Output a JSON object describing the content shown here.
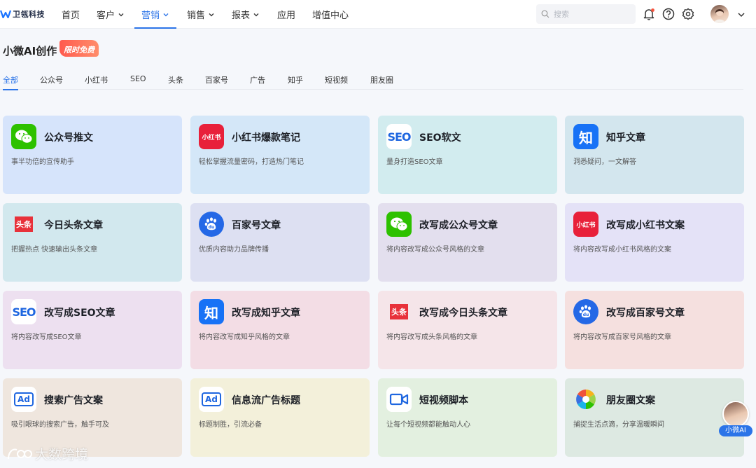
{
  "brand": {
    "name": "卫瓴科技"
  },
  "nav": {
    "items": [
      {
        "label": "首页"
      },
      {
        "label": "客户"
      },
      {
        "label": "营销"
      },
      {
        "label": "销售"
      },
      {
        "label": "报表"
      },
      {
        "label": "应用"
      },
      {
        "label": "增值中心"
      }
    ],
    "active": "营销"
  },
  "search": {
    "placeholder": "搜索"
  },
  "page": {
    "title": "小微AI创作",
    "badge": "限时免费"
  },
  "tabs": [
    {
      "label": "全部"
    },
    {
      "label": "公众号"
    },
    {
      "label": "小红书"
    },
    {
      "label": "SEO"
    },
    {
      "label": "头条"
    },
    {
      "label": "百家号"
    },
    {
      "label": "广告"
    },
    {
      "label": "知乎"
    },
    {
      "label": "短视频"
    },
    {
      "label": "朋友圈"
    }
  ],
  "active_tab": "全部",
  "cards": [
    {
      "title": "公众号推文",
      "desc": "事半功倍的宣传助手",
      "icon": "wechat-icon"
    },
    {
      "title": "小红书爆款笔记",
      "desc": "轻松掌握流量密码，打造热门笔记",
      "icon": "xiaohongshu-icon"
    },
    {
      "title": "SEO软文",
      "desc": "量身打造SEO文章",
      "icon": "seo-icon"
    },
    {
      "title": "知乎文章",
      "desc": "洞悉疑问，一文解答",
      "icon": "zhihu-icon"
    },
    {
      "title": "今日头条文章",
      "desc": "把握热点 快速输出头条文章",
      "icon": "toutiao-icon"
    },
    {
      "title": "百家号文章",
      "desc": "优质内容助力品牌传播",
      "icon": "baijiahao-icon"
    },
    {
      "title": "改写成公众号文章",
      "desc": "将内容改写成公众号风格的文章",
      "icon": "wechat-icon"
    },
    {
      "title": "改写成小红书文案",
      "desc": "将内容改写成小红书风格的文案",
      "icon": "xiaohongshu-icon"
    },
    {
      "title": "改写成SEO文章",
      "desc": "将内容改写成SEO文章",
      "icon": "seo-icon"
    },
    {
      "title": "改写成知乎文章",
      "desc": "将内容改写成知乎风格的文章",
      "icon": "zhihu-icon"
    },
    {
      "title": "改写成今日头条文章",
      "desc": "将内容改写成头条风格的文章",
      "icon": "toutiao-icon"
    },
    {
      "title": "改写成百家号文章",
      "desc": "将内容改写成百家号风格的文章",
      "icon": "baijiahao-icon"
    },
    {
      "title": "搜索广告文案",
      "desc": "吸引眼球的搜索广告，触手可及",
      "icon": "ad-icon"
    },
    {
      "title": "信息流广告标题",
      "desc": "标题制胜，引流必备",
      "icon": "ad-icon"
    },
    {
      "title": "短视频脚本",
      "desc": "让每个短视频都能触动人心",
      "icon": "video-camera-icon"
    },
    {
      "title": "朋友圈文案",
      "desc": "捕捉生活点滴，分享温暖瞬间",
      "icon": "moments-icon"
    }
  ],
  "icon_text": {
    "xiaohongshu": "小红书",
    "seo": "SEO",
    "zhihu": "知",
    "toutiao": "头条",
    "ad": "Ad"
  },
  "colors": {
    "accent": "#2b74e8",
    "wechat": "#2dc100",
    "xiaohongshu": "#e8203a",
    "zhihu": "#1772f6",
    "toutiao": "#e8313a"
  },
  "helper": {
    "label": "小微AI"
  },
  "watermark": {
    "text": "大数跨境"
  }
}
